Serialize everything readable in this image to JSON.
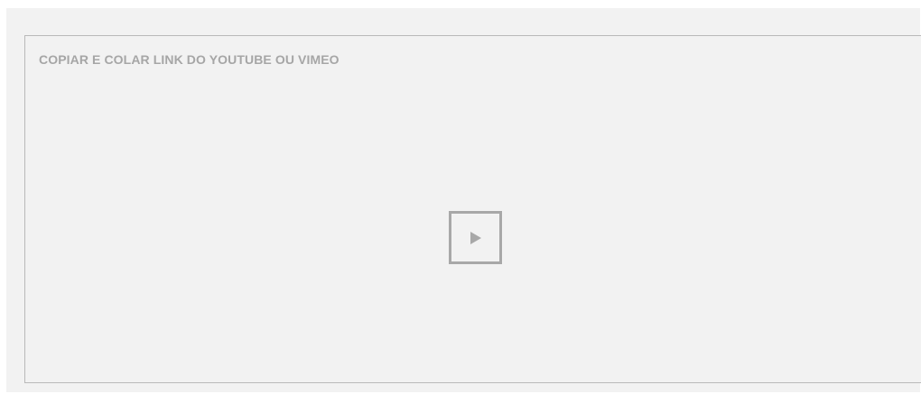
{
  "video_embed": {
    "placeholder": "COPIAR E COLAR LINK DO YOUTUBE OU VIMEO",
    "play_icon": "play-icon"
  },
  "colors": {
    "panel_background": "#f2f2f2",
    "border": "#b9b9b9",
    "placeholder_text": "#a6a6a6",
    "icon": "#a8a8a8"
  }
}
